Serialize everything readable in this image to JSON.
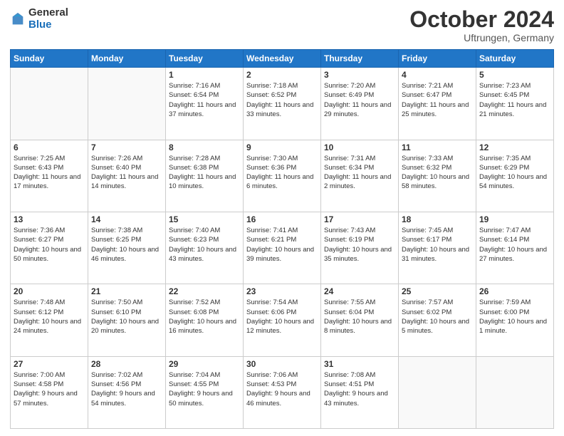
{
  "header": {
    "logo": {
      "general": "General",
      "blue": "Blue"
    },
    "title": "October 2024",
    "location": "Uftrungen, Germany"
  },
  "weekdays": [
    "Sunday",
    "Monday",
    "Tuesday",
    "Wednesday",
    "Thursday",
    "Friday",
    "Saturday"
  ],
  "weeks": [
    [
      {
        "day": null
      },
      {
        "day": null
      },
      {
        "day": "1",
        "sunrise": "Sunrise: 7:16 AM",
        "sunset": "Sunset: 6:54 PM",
        "daylight": "Daylight: 11 hours and 37 minutes."
      },
      {
        "day": "2",
        "sunrise": "Sunrise: 7:18 AM",
        "sunset": "Sunset: 6:52 PM",
        "daylight": "Daylight: 11 hours and 33 minutes."
      },
      {
        "day": "3",
        "sunrise": "Sunrise: 7:20 AM",
        "sunset": "Sunset: 6:49 PM",
        "daylight": "Daylight: 11 hours and 29 minutes."
      },
      {
        "day": "4",
        "sunrise": "Sunrise: 7:21 AM",
        "sunset": "Sunset: 6:47 PM",
        "daylight": "Daylight: 11 hours and 25 minutes."
      },
      {
        "day": "5",
        "sunrise": "Sunrise: 7:23 AM",
        "sunset": "Sunset: 6:45 PM",
        "daylight": "Daylight: 11 hours and 21 minutes."
      }
    ],
    [
      {
        "day": "6",
        "sunrise": "Sunrise: 7:25 AM",
        "sunset": "Sunset: 6:43 PM",
        "daylight": "Daylight: 11 hours and 17 minutes."
      },
      {
        "day": "7",
        "sunrise": "Sunrise: 7:26 AM",
        "sunset": "Sunset: 6:40 PM",
        "daylight": "Daylight: 11 hours and 14 minutes."
      },
      {
        "day": "8",
        "sunrise": "Sunrise: 7:28 AM",
        "sunset": "Sunset: 6:38 PM",
        "daylight": "Daylight: 11 hours and 10 minutes."
      },
      {
        "day": "9",
        "sunrise": "Sunrise: 7:30 AM",
        "sunset": "Sunset: 6:36 PM",
        "daylight": "Daylight: 11 hours and 6 minutes."
      },
      {
        "day": "10",
        "sunrise": "Sunrise: 7:31 AM",
        "sunset": "Sunset: 6:34 PM",
        "daylight": "Daylight: 11 hours and 2 minutes."
      },
      {
        "day": "11",
        "sunrise": "Sunrise: 7:33 AM",
        "sunset": "Sunset: 6:32 PM",
        "daylight": "Daylight: 10 hours and 58 minutes."
      },
      {
        "day": "12",
        "sunrise": "Sunrise: 7:35 AM",
        "sunset": "Sunset: 6:29 PM",
        "daylight": "Daylight: 10 hours and 54 minutes."
      }
    ],
    [
      {
        "day": "13",
        "sunrise": "Sunrise: 7:36 AM",
        "sunset": "Sunset: 6:27 PM",
        "daylight": "Daylight: 10 hours and 50 minutes."
      },
      {
        "day": "14",
        "sunrise": "Sunrise: 7:38 AM",
        "sunset": "Sunset: 6:25 PM",
        "daylight": "Daylight: 10 hours and 46 minutes."
      },
      {
        "day": "15",
        "sunrise": "Sunrise: 7:40 AM",
        "sunset": "Sunset: 6:23 PM",
        "daylight": "Daylight: 10 hours and 43 minutes."
      },
      {
        "day": "16",
        "sunrise": "Sunrise: 7:41 AM",
        "sunset": "Sunset: 6:21 PM",
        "daylight": "Daylight: 10 hours and 39 minutes."
      },
      {
        "day": "17",
        "sunrise": "Sunrise: 7:43 AM",
        "sunset": "Sunset: 6:19 PM",
        "daylight": "Daylight: 10 hours and 35 minutes."
      },
      {
        "day": "18",
        "sunrise": "Sunrise: 7:45 AM",
        "sunset": "Sunset: 6:17 PM",
        "daylight": "Daylight: 10 hours and 31 minutes."
      },
      {
        "day": "19",
        "sunrise": "Sunrise: 7:47 AM",
        "sunset": "Sunset: 6:14 PM",
        "daylight": "Daylight: 10 hours and 27 minutes."
      }
    ],
    [
      {
        "day": "20",
        "sunrise": "Sunrise: 7:48 AM",
        "sunset": "Sunset: 6:12 PM",
        "daylight": "Daylight: 10 hours and 24 minutes."
      },
      {
        "day": "21",
        "sunrise": "Sunrise: 7:50 AM",
        "sunset": "Sunset: 6:10 PM",
        "daylight": "Daylight: 10 hours and 20 minutes."
      },
      {
        "day": "22",
        "sunrise": "Sunrise: 7:52 AM",
        "sunset": "Sunset: 6:08 PM",
        "daylight": "Daylight: 10 hours and 16 minutes."
      },
      {
        "day": "23",
        "sunrise": "Sunrise: 7:54 AM",
        "sunset": "Sunset: 6:06 PM",
        "daylight": "Daylight: 10 hours and 12 minutes."
      },
      {
        "day": "24",
        "sunrise": "Sunrise: 7:55 AM",
        "sunset": "Sunset: 6:04 PM",
        "daylight": "Daylight: 10 hours and 8 minutes."
      },
      {
        "day": "25",
        "sunrise": "Sunrise: 7:57 AM",
        "sunset": "Sunset: 6:02 PM",
        "daylight": "Daylight: 10 hours and 5 minutes."
      },
      {
        "day": "26",
        "sunrise": "Sunrise: 7:59 AM",
        "sunset": "Sunset: 6:00 PM",
        "daylight": "Daylight: 10 hours and 1 minute."
      }
    ],
    [
      {
        "day": "27",
        "sunrise": "Sunrise: 7:00 AM",
        "sunset": "Sunset: 4:58 PM",
        "daylight": "Daylight: 9 hours and 57 minutes."
      },
      {
        "day": "28",
        "sunrise": "Sunrise: 7:02 AM",
        "sunset": "Sunset: 4:56 PM",
        "daylight": "Daylight: 9 hours and 54 minutes."
      },
      {
        "day": "29",
        "sunrise": "Sunrise: 7:04 AM",
        "sunset": "Sunset: 4:55 PM",
        "daylight": "Daylight: 9 hours and 50 minutes."
      },
      {
        "day": "30",
        "sunrise": "Sunrise: 7:06 AM",
        "sunset": "Sunset: 4:53 PM",
        "daylight": "Daylight: 9 hours and 46 minutes."
      },
      {
        "day": "31",
        "sunrise": "Sunrise: 7:08 AM",
        "sunset": "Sunset: 4:51 PM",
        "daylight": "Daylight: 9 hours and 43 minutes."
      },
      {
        "day": null
      },
      {
        "day": null
      }
    ]
  ]
}
